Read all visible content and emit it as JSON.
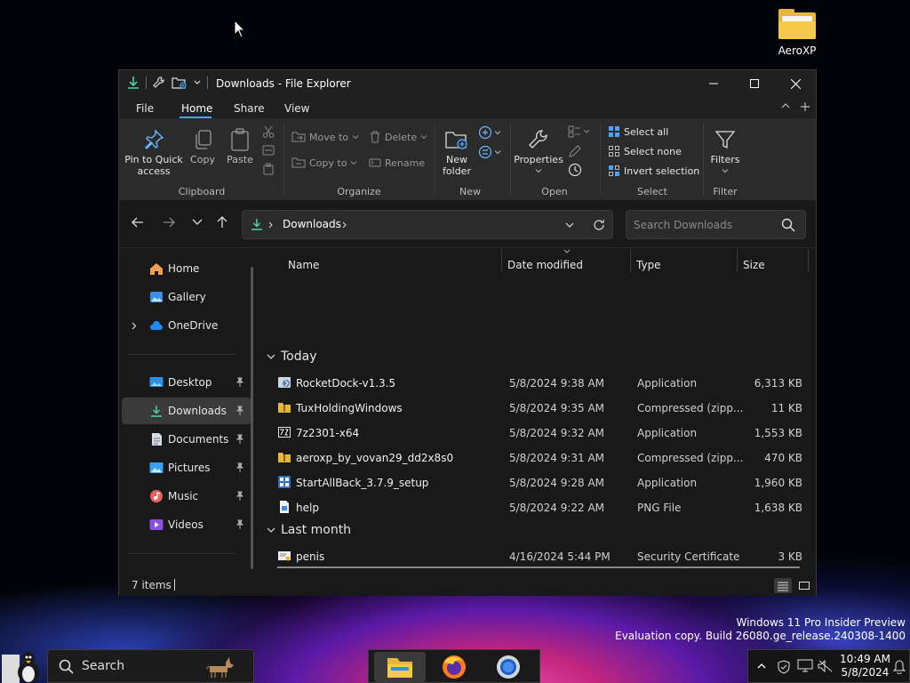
{
  "desktop": {
    "icon_label": "AeroXP"
  },
  "window": {
    "title": "Downloads - File Explorer",
    "ribbon_tabs": [
      "File",
      "Home",
      "Share",
      "View"
    ],
    "ribbon": {
      "clipboard": {
        "pin": "Pin to Quick",
        "pin2": "access",
        "copy": "Copy",
        "paste": "Paste",
        "label": "Clipboard"
      },
      "organize": {
        "move_to": "Move to",
        "copy_to": "Copy to",
        "delete": "Delete",
        "rename": "Rename",
        "label": "Organize"
      },
      "new": {
        "new_folder": "New",
        "new_folder2": "folder",
        "label": "New"
      },
      "open": {
        "properties": "Properties",
        "label": "Open"
      },
      "select": {
        "select_all": "Select all",
        "select_none": "Select none",
        "invert": "Invert selection",
        "label": "Select"
      },
      "filter": {
        "filters": "Filters",
        "label": "Filter"
      }
    },
    "address": {
      "location": "Downloads"
    },
    "search": {
      "placeholder": "Search Downloads"
    },
    "nav": {
      "home": "Home",
      "gallery": "Gallery",
      "onedrive": "OneDrive",
      "desktop": "Desktop",
      "downloads": "Downloads",
      "documents": "Documents",
      "pictures": "Pictures",
      "music": "Music",
      "videos": "Videos"
    },
    "columns": {
      "name": "Name",
      "date": "Date modified",
      "type": "Type",
      "size": "Size"
    },
    "groups": [
      {
        "label": "Today",
        "files": [
          {
            "name": "RocketDock-v1.3.5",
            "date": "5/8/2024 9:38 AM",
            "type": "Application",
            "size": "6,313 KB"
          },
          {
            "name": "TuxHoldingWindows",
            "date": "5/8/2024 9:35 AM",
            "type": "Compressed (zipp...",
            "size": "11 KB"
          },
          {
            "name": "7z2301-x64",
            "date": "5/8/2024 9:32 AM",
            "type": "Application",
            "size": "1,553 KB"
          },
          {
            "name": "aeroxp_by_vovan29_dd2x8s0",
            "date": "5/8/2024 9:31 AM",
            "type": "Compressed (zipp...",
            "size": "470 KB"
          },
          {
            "name": "StartAllBack_3.7.9_setup",
            "date": "5/8/2024 9:28 AM",
            "type": "Application",
            "size": "1,960 KB"
          },
          {
            "name": "help",
            "date": "5/8/2024 9:22 AM",
            "type": "PNG File",
            "size": "1,638 KB"
          }
        ]
      },
      {
        "label": "Last month",
        "files": [
          {
            "name": "penis",
            "date": "4/16/2024 5:44 PM",
            "type": "Security Certificate",
            "size": "3 KB"
          }
        ]
      }
    ],
    "status": {
      "items": "7 items"
    }
  },
  "watermark": {
    "line1": "Windows 11 Pro Insider Preview",
    "line2": "Evaluation copy. Build 26080.ge_release.240308-1400"
  },
  "taskbar": {
    "search_label": "Search",
    "time": "10:49 AM",
    "date": "5/8/2024"
  },
  "colors": {
    "accent": "#4aa3ff",
    "folder": "#e8b53d",
    "window_bg": "#191919",
    "ribbon_bg": "#2b2b2b"
  }
}
